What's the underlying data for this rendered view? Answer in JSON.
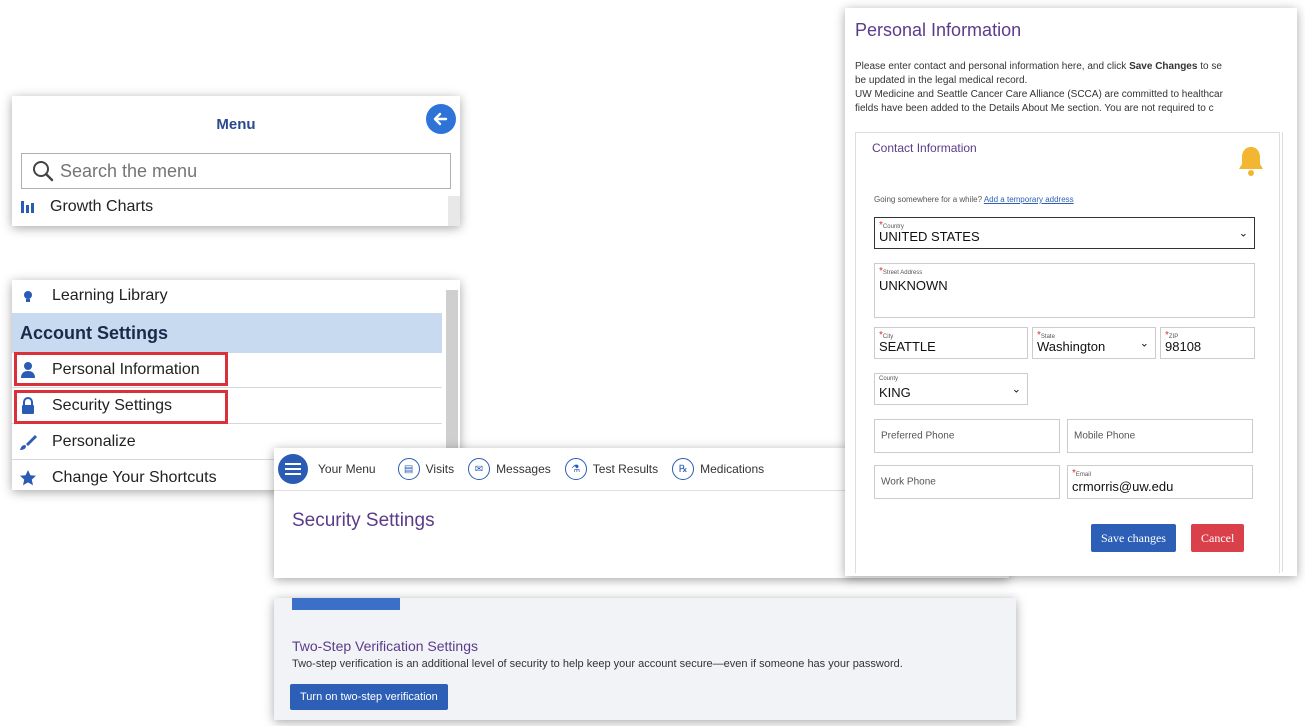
{
  "menu": {
    "title": "Menu",
    "search_placeholder": "Search the menu",
    "growth_charts": "Growth Charts",
    "learning_library": "Learning Library",
    "section_account": "Account Settings",
    "personal_information": "Personal Information",
    "security_settings": "Security Settings",
    "personalize": "Personalize",
    "change_shortcuts": "Change Your Shortcuts"
  },
  "topnav": {
    "your_menu": "Your Menu",
    "visits": "Visits",
    "messages": "Messages",
    "test_results": "Test Results",
    "medications": "Medications"
  },
  "security": {
    "title": "Security Settings"
  },
  "twostep": {
    "title": "Two-Step Verification Settings",
    "description": "Two-step verification is an additional level of security to help keep your account secure—even if someone has your password.",
    "button": "Turn on two-step verification"
  },
  "personal": {
    "title": "Personal Information",
    "intro_line1_a": "Please enter contact and personal information here, and click ",
    "intro_line1_b": "Save Changes",
    "intro_line1_c": " to se",
    "intro_line2": "be updated in the legal medical record.",
    "intro_line3": "UW Medicine and Seattle Cancer Care Alliance (SCCA) are committed to healthcar",
    "intro_line4": "fields have been added to the Details About Me section. You are not required to c",
    "contact_title": "Contact Information",
    "going_text": "Going somewhere for a while? ",
    "temp_address_link": "Add a temporary address",
    "country_label": "Country",
    "country_value": "UNITED STATES",
    "street_label": "Street Address",
    "street_value": "UNKNOWN",
    "city_label": "City",
    "city_value": "SEATTLE",
    "state_label": "State",
    "state_value": "Washington",
    "zip_label": "ZIP",
    "zip_value": "98108",
    "county_label": "County",
    "county_value": "KING",
    "preferred_phone_placeholder": "Preferred Phone",
    "mobile_phone_placeholder": "Mobile Phone",
    "work_phone_placeholder": "Work Phone",
    "email_label": "Email",
    "email_value": "crmorris@uw.edu",
    "save_button": "Save changes",
    "cancel_button": "Cancel"
  },
  "colors": {
    "accent_blue": "#2d5fb6",
    "title_purple": "#5b3b8a",
    "highlight_red": "#d9303a",
    "section_blue": "#c8daf0",
    "cancel_red": "#d9404a",
    "bell_yellow": "#f2b632"
  },
  "icons": [
    "back-arrow-icon",
    "search-icon",
    "growth-chart-icon",
    "lightbulb-icon",
    "person-icon",
    "lock-icon",
    "brush-icon",
    "star-icon",
    "hamburger-icon",
    "calendar-icon",
    "envelope-icon",
    "flask-icon",
    "pill-icon",
    "bell-icon"
  ]
}
